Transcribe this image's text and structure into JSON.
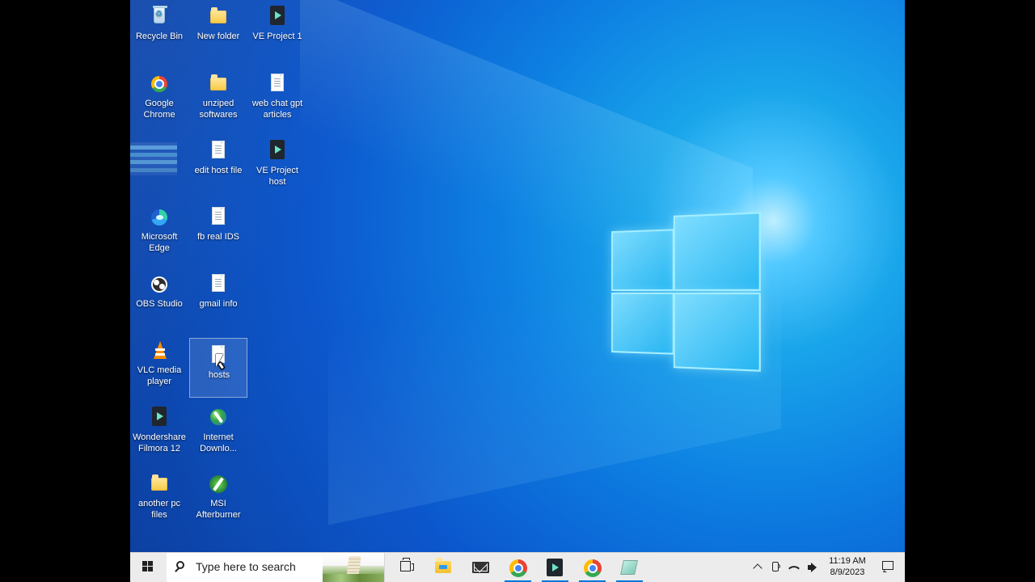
{
  "desktop": {
    "icons": [
      {
        "label": "Recycle Bin",
        "icon": "recycle-bin-icon"
      },
      {
        "label": "New folder",
        "icon": "folder-icon"
      },
      {
        "label": "VE Project 1",
        "icon": "video-project-icon"
      },
      {
        "label": "Google\nChrome",
        "icon": "chrome-icon"
      },
      {
        "label": "unziped\nsoftwares",
        "icon": "folder-icon"
      },
      {
        "label": "web chat gpt\narticles",
        "icon": "text-file-icon"
      },
      {
        "label": "edit host file",
        "icon": "text-file-icon"
      },
      {
        "label": "VE Project\nhost",
        "icon": "video-project-icon"
      },
      {
        "label": "Microsoft\nEdge",
        "icon": "edge-icon"
      },
      {
        "label": "fb real IDS",
        "icon": "text-file-icon"
      },
      {
        "label": "OBS Studio",
        "icon": "obs-icon"
      },
      {
        "label": "gmail info",
        "icon": "document-icon"
      },
      {
        "label": "VLC media\nplayer",
        "icon": "vlc-icon"
      },
      {
        "label": "hosts",
        "icon": "file-icon",
        "selected": true
      },
      {
        "label": "Wondershare\nFilmora 12",
        "icon": "filmora-icon"
      },
      {
        "label": "Internet\nDownlo...",
        "icon": "download-manager-icon"
      },
      {
        "label": "another pc\nfiles",
        "icon": "zip-folder-icon"
      },
      {
        "label": "MSI\nAfterburner",
        "icon": "afterburner-icon"
      }
    ]
  },
  "taskbar": {
    "search_placeholder": "Type here to search",
    "pinned": [
      {
        "name": "task-view",
        "icon": "task-view-icon"
      },
      {
        "name": "file-explorer",
        "icon": "file-explorer-icon"
      },
      {
        "name": "mail",
        "icon": "mail-icon"
      },
      {
        "name": "chrome",
        "icon": "chrome-icon",
        "active": true
      },
      {
        "name": "filmora",
        "icon": "filmora-icon",
        "active": true
      },
      {
        "name": "chrome-profile",
        "icon": "chrome-icon",
        "active": true
      },
      {
        "name": "notes",
        "icon": "notes-icon",
        "active": true
      }
    ],
    "tray": {
      "time": "11:19 AM",
      "date": "8/9/2023"
    }
  },
  "colors": {
    "taskbar_bg": "#ececec",
    "accent": "#0078d7",
    "desktop_bg": "#1276dc"
  }
}
